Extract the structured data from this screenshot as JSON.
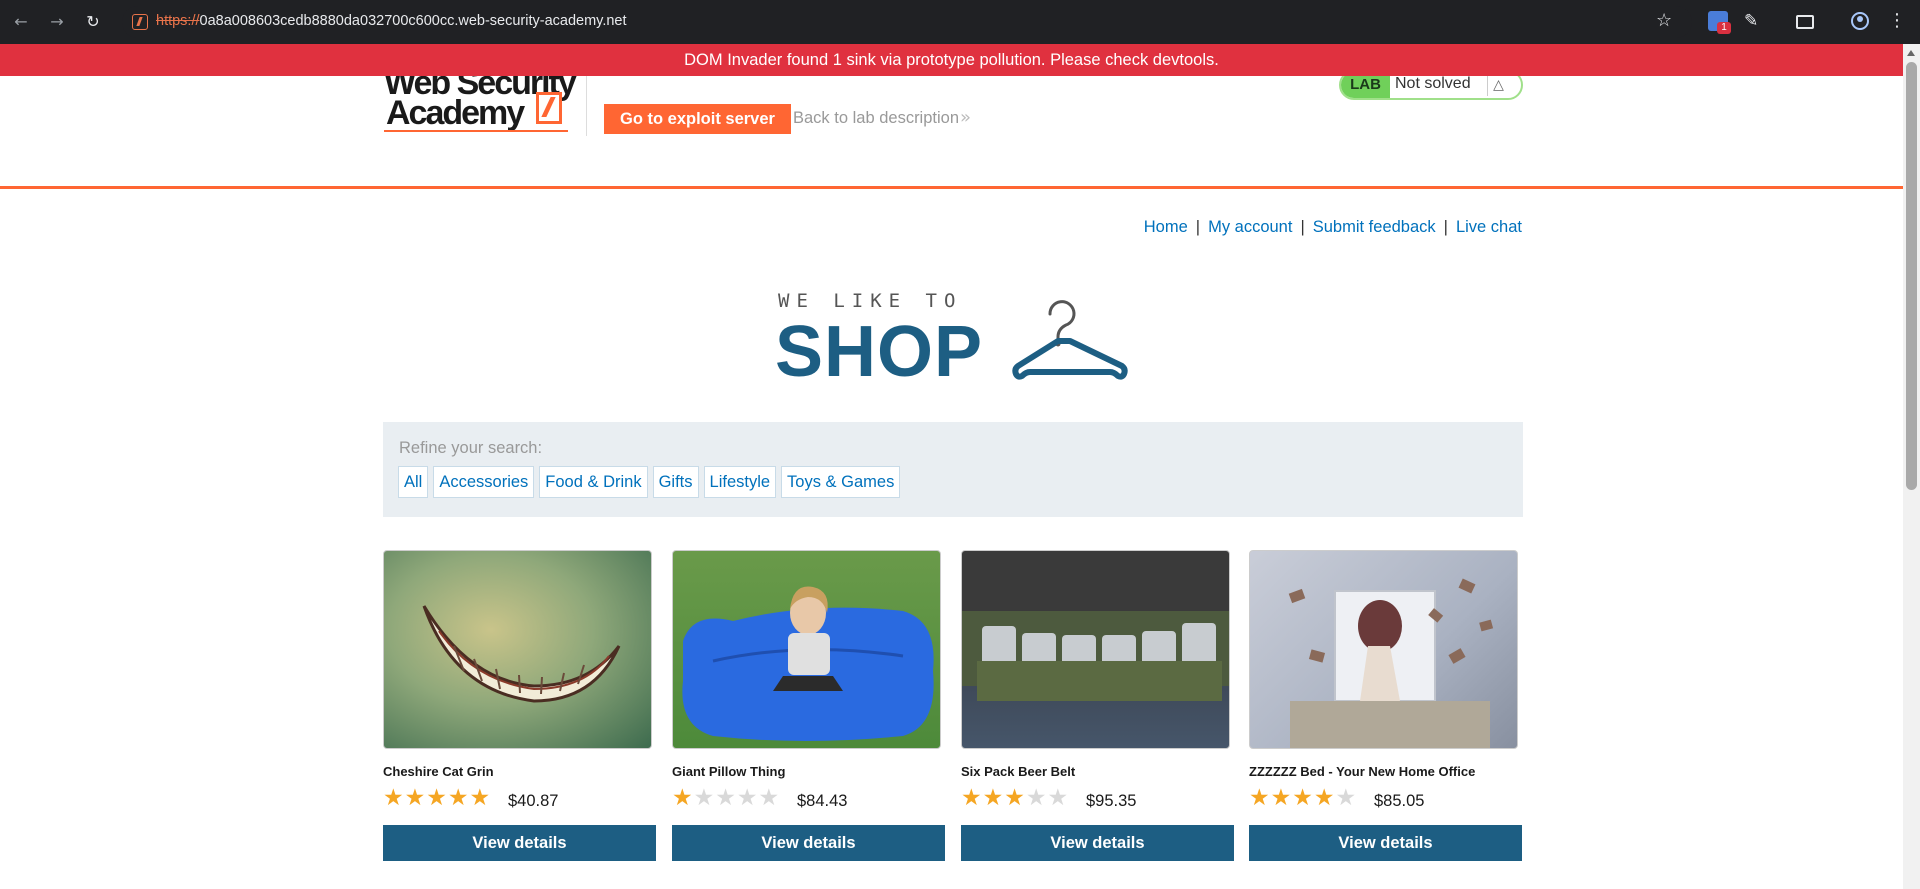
{
  "browser": {
    "url_scheme": "https://",
    "url_rest": "0a8a008603cedb8880da032700c600cc.web-security-academy.net",
    "ext_badge_count": "1",
    "icons": [
      "back-icon",
      "forward-icon",
      "reload-icon",
      "site-icon",
      "bookmark-star-icon",
      "dom-invader-icon",
      "extensions-icon",
      "cast-icon",
      "profile-icon",
      "menu-icon"
    ]
  },
  "banner": {
    "text": "DOM Invader found 1 sink via prototype pollution. Please check devtools.",
    "color": "#e0313f"
  },
  "header": {
    "logo_line1": "Web Security",
    "logo_line2": "Academy",
    "exploit_button": "Go to exploit server",
    "back_link": "Back to lab description",
    "lab_badge": "LAB",
    "lab_status": "Not solved",
    "accent_color": "#ff6633"
  },
  "nav": {
    "home": "Home",
    "account": "My account",
    "feedback": "Submit feedback",
    "chat": "Live chat",
    "separator": "|"
  },
  "shop_logo": {
    "tagline": "WE LIKE TO",
    "word": "SHOP",
    "color": "#1d5e83"
  },
  "filters": {
    "label": "Refine your search:",
    "tags": [
      "All",
      "Accessories",
      "Food & Drink",
      "Gifts",
      "Lifestyle",
      "Toys & Games"
    ]
  },
  "products": [
    {
      "name": "Cheshire Cat Grin",
      "rating": 5,
      "max_rating": 5,
      "price": "$40.87",
      "button": "View details"
    },
    {
      "name": "Giant Pillow Thing",
      "rating": 1,
      "max_rating": 5,
      "price": "$84.43",
      "button": "View details"
    },
    {
      "name": "Six Pack Beer Belt",
      "rating": 3,
      "max_rating": 5,
      "price": "$95.35",
      "button": "View details"
    },
    {
      "name": "ZZZZZZ Bed - Your New Home Office",
      "rating": 4,
      "max_rating": 5,
      "price": "$85.05",
      "button": "View details"
    }
  ]
}
